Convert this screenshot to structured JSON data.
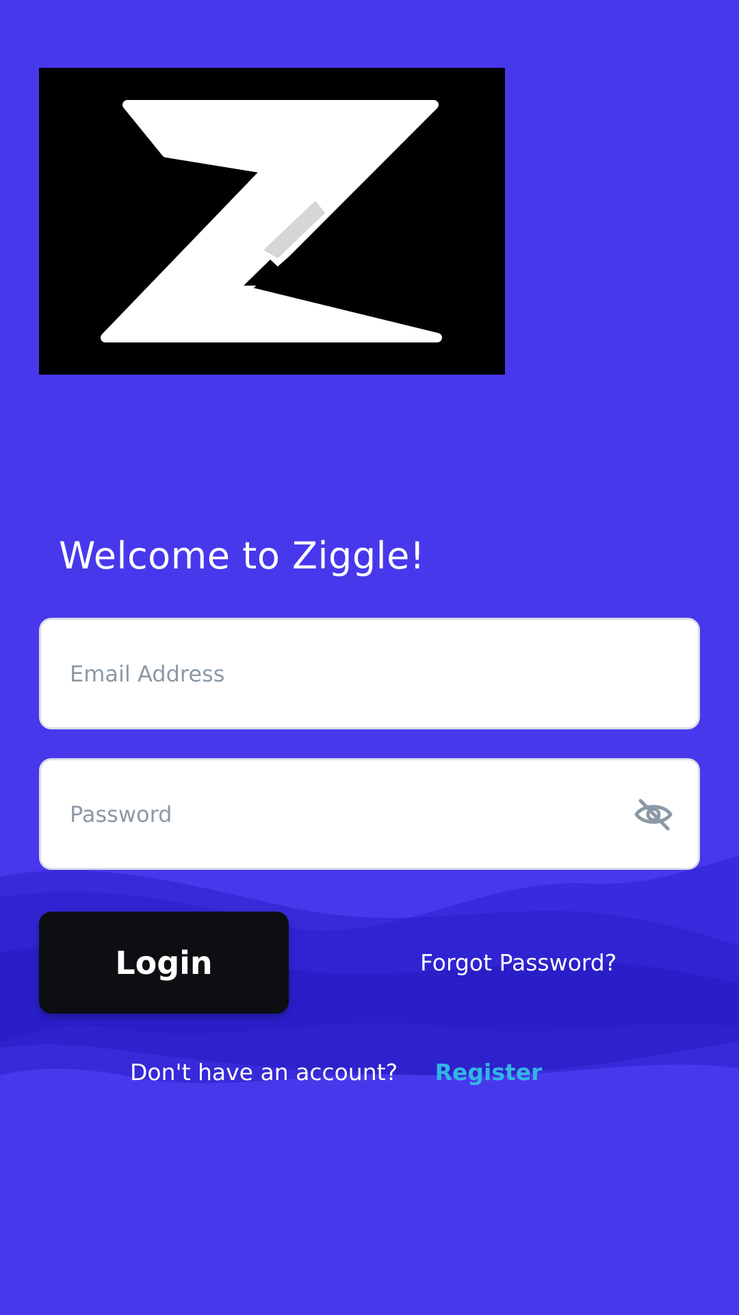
{
  "logo": {
    "name": "ziggle-logo-icon",
    "letter": "Z",
    "background": "#000000"
  },
  "welcome": {
    "title": "Welcome to Ziggle!"
  },
  "form": {
    "email_placeholder": "Email Address",
    "email_value": "",
    "password_placeholder": "Password",
    "password_value": "",
    "visibility_icon": "eye-off-icon"
  },
  "actions": {
    "login_label": "Login",
    "forgot_label": "Forgot Password?"
  },
  "footer": {
    "question": "Don't have an account?",
    "register_label": "Register"
  },
  "colors": {
    "background": "#4838EC",
    "button": "#0C0E12",
    "link": "#33B5E5",
    "field_border": "#D9DEE8",
    "placeholder": "#8C99A5"
  }
}
